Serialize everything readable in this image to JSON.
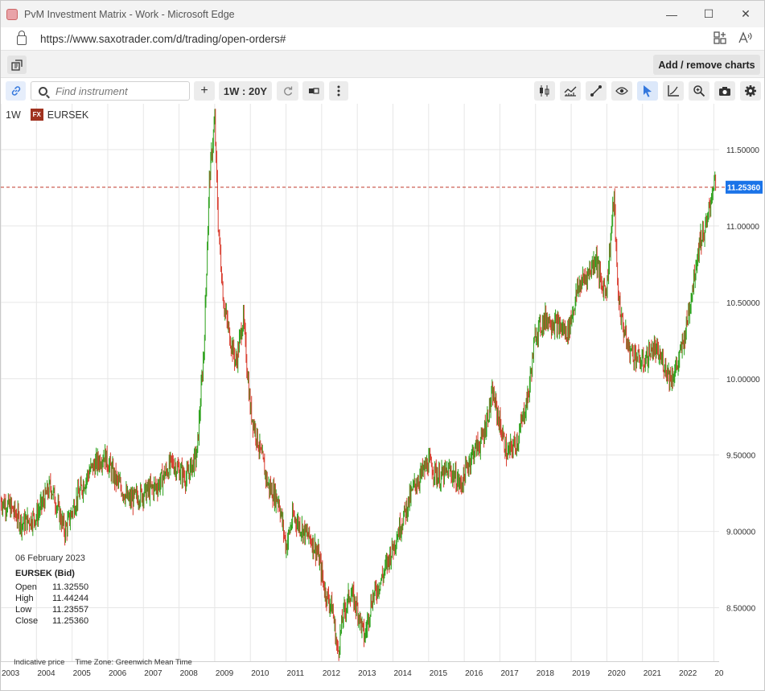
{
  "window": {
    "title": "PvM Investment Matrix - Work - Microsoft Edge",
    "minimize": "—",
    "maximize": "☐",
    "close": "✕"
  },
  "address": {
    "url": "https://www.saxotrader.com/d/trading/open-orders#"
  },
  "topbar": {
    "add_remove_label": "Add / remove charts"
  },
  "toolbar": {
    "search_placeholder": "Find instrument",
    "add": "+",
    "interval": "1W : 20Y"
  },
  "chart": {
    "interval_label": "1W",
    "fx_badge": "FX",
    "symbol": "EURSEK",
    "current_price_label": "11.25360",
    "info": {
      "date": "06 February 2023",
      "symbol": "EURSEK (Bid)",
      "open_label": "Open",
      "open": "11.32550",
      "high_label": "High",
      "high": "11.44244",
      "low_label": "Low",
      "low": "11.23557",
      "close_label": "Close",
      "close": "11.25360"
    },
    "footer": {
      "indicative": "Indicative price",
      "timezone": "Time Zone: Greenwich Mean Time"
    }
  },
  "chart_data": {
    "type": "line",
    "title": "",
    "xlabel": "",
    "ylabel": "",
    "ylim": [
      8.15,
      11.8
    ],
    "yticks": [
      "11.50000",
      "11.00000",
      "10.50000",
      "10.00000",
      "9.50000",
      "9.00000",
      "8.50000"
    ],
    "ytick_values": [
      11.5,
      11.0,
      10.5,
      10.0,
      9.5,
      9.0,
      8.5
    ],
    "xticks": [
      "2003",
      "2004",
      "2005",
      "2006",
      "2007",
      "2008",
      "2009",
      "2010",
      "2011",
      "2012",
      "2013",
      "2014",
      "2015",
      "2016",
      "2017",
      "2018",
      "2019",
      "2020",
      "2021",
      "2022",
      "20"
    ],
    "xlim": [
      2003.0,
      2023.15
    ],
    "current_price": 11.2536,
    "up_color": "#2ba01a",
    "down_color": "#d8392b",
    "series": [
      {
        "x": [
          2003.0,
          2003.3,
          2003.6,
          2004.0,
          2004.4,
          2004.8,
          2005.1,
          2005.5,
          2005.9,
          2006.2,
          2006.6,
          2007.0,
          2007.4,
          2007.8,
          2008.2,
          2008.5,
          2008.7,
          2008.85,
          2009.0,
          2009.1,
          2009.25,
          2009.4,
          2009.6,
          2009.8,
          2010.0,
          2010.2,
          2010.5,
          2010.8,
          2011.0,
          2011.2,
          2011.5,
          2011.7,
          2011.9,
          2012.1,
          2012.3,
          2012.45,
          2012.6,
          2012.8,
          2013.0,
          2013.2,
          2013.4,
          2013.7,
          2014.0,
          2014.3,
          2014.6,
          2015.0,
          2015.3,
          2015.6,
          2015.9,
          2016.2,
          2016.5,
          2016.8,
          2017.0,
          2017.2,
          2017.5,
          2017.8,
          2018.0,
          2018.3,
          2018.6,
          2018.9,
          2019.2,
          2019.5,
          2019.7,
          2019.85,
          2020.0,
          2020.1,
          2020.2,
          2020.3,
          2020.4,
          2020.6,
          2020.8,
          2021.0,
          2021.3,
          2021.6,
          2021.8,
          2022.0,
          2022.2,
          2022.4,
          2022.6,
          2022.8,
          2023.0,
          2023.1
        ],
        "y": [
          9.2,
          9.15,
          9.05,
          9.1,
          9.3,
          9.0,
          9.2,
          9.4,
          9.5,
          9.35,
          9.2,
          9.25,
          9.3,
          9.45,
          9.35,
          9.5,
          10.2,
          11.3,
          11.7,
          11.0,
          10.5,
          10.3,
          10.1,
          10.4,
          9.8,
          9.6,
          9.3,
          9.2,
          8.9,
          9.1,
          9.0,
          8.95,
          8.85,
          8.6,
          8.5,
          8.2,
          8.45,
          8.6,
          8.5,
          8.3,
          8.55,
          8.7,
          8.9,
          9.1,
          9.3,
          9.45,
          9.35,
          9.4,
          9.3,
          9.5,
          9.6,
          9.9,
          9.7,
          9.5,
          9.6,
          9.9,
          10.3,
          10.4,
          10.35,
          10.3,
          10.6,
          10.7,
          10.8,
          10.6,
          10.6,
          10.9,
          11.2,
          10.6,
          10.4,
          10.2,
          10.15,
          10.1,
          10.2,
          10.1,
          10.0,
          10.1,
          10.3,
          10.6,
          10.9,
          11.0,
          11.3,
          11.25
        ]
      }
    ]
  }
}
